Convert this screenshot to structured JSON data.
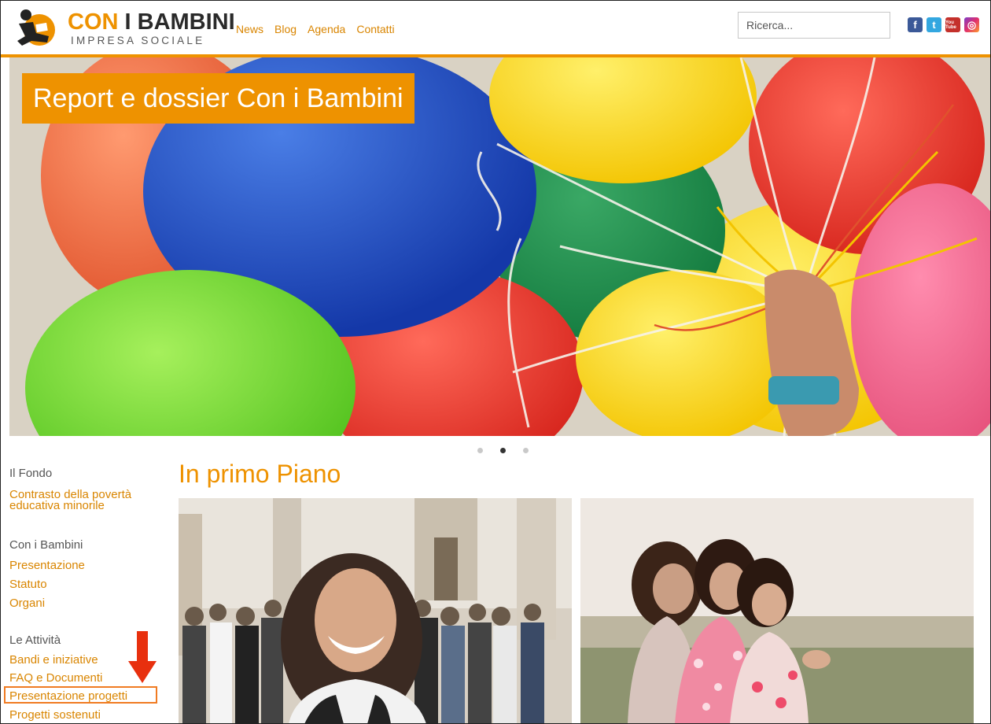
{
  "header": {
    "logo": {
      "title_part1": "CON",
      "title_part2": "I BAMBINI",
      "subtitle": "IMPRESA SOCIALE"
    },
    "nav": [
      "News",
      "Blog",
      "Agenda",
      "Contatti"
    ],
    "search": {
      "placeholder": "Ricerca..."
    },
    "socials": [
      {
        "icon": "facebook-icon",
        "glyph": "f"
      },
      {
        "icon": "twitter-icon",
        "glyph": "t"
      },
      {
        "icon": "youtube-icon",
        "glyph": "You Tube"
      },
      {
        "icon": "instagram-icon",
        "glyph": "◎"
      }
    ]
  },
  "hero": {
    "title": "Report e dossier Con i Bambini",
    "carousel": {
      "count": 3,
      "active_index": 1
    }
  },
  "sidebar": {
    "groups": [
      {
        "heading": "Il Fondo",
        "links": [
          "Contrasto della povertà educativa minorile"
        ]
      },
      {
        "heading": "Con i Bambini",
        "links": [
          "Presentazione",
          "Statuto",
          "Organi"
        ]
      },
      {
        "heading": "Le Attività",
        "links": [
          "Bandi e iniziative",
          "FAQ e Documenti",
          "Presentazione progetti",
          "Progetti sostenuti"
        ]
      }
    ],
    "highlighted_link": "Presentazione progetti"
  },
  "main": {
    "section_title": "In primo Piano"
  },
  "colors": {
    "accent": "#ee9200",
    "link": "#d98500",
    "highlight": "#f07b22"
  }
}
